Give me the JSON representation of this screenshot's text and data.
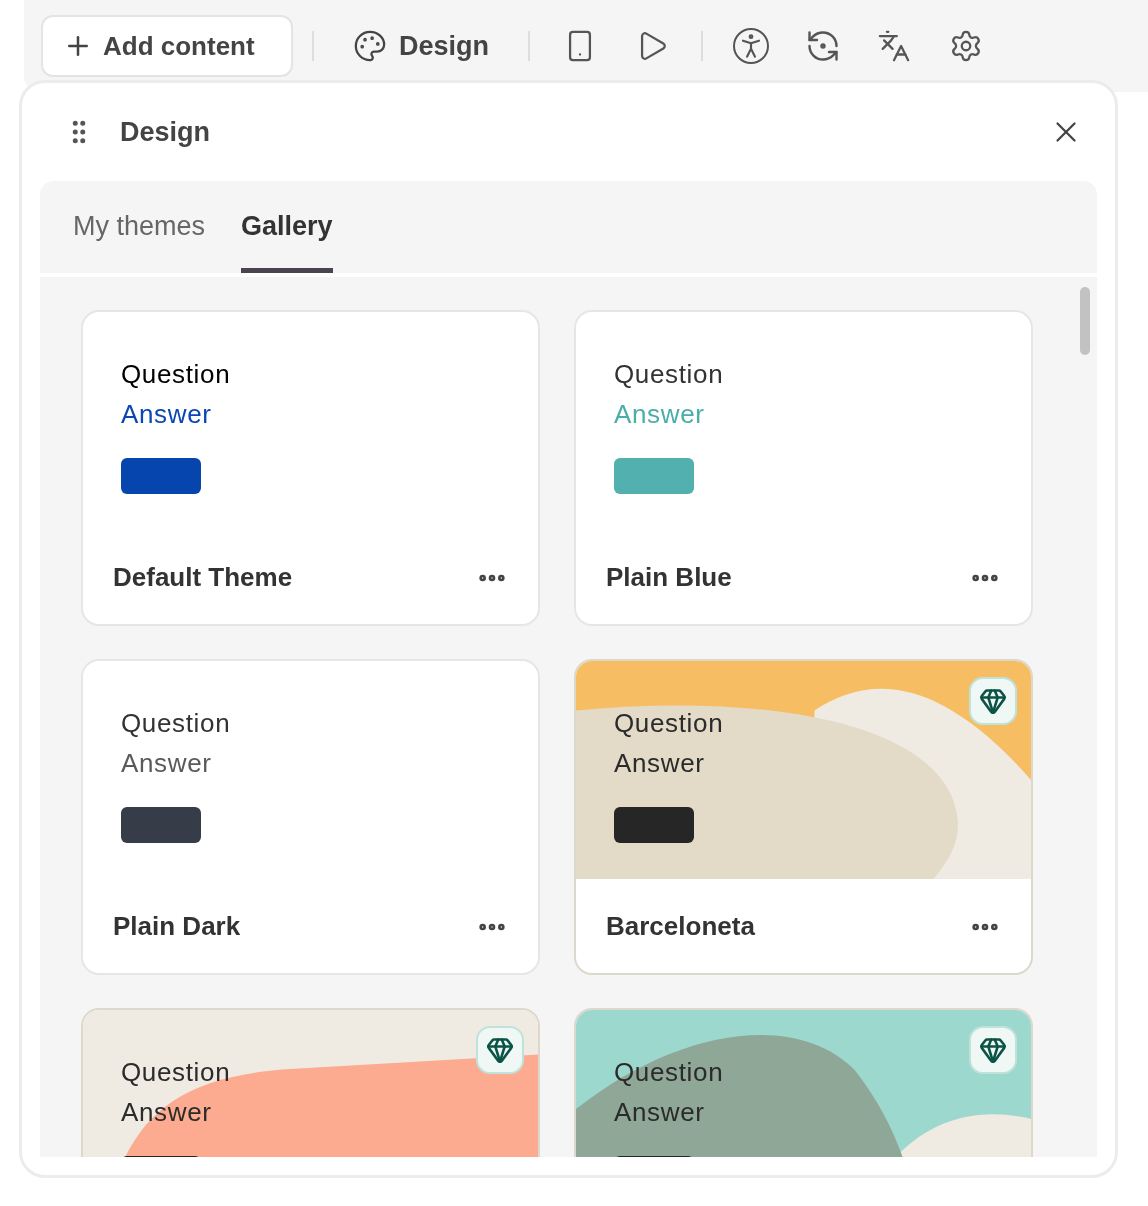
{
  "toolbar": {
    "add_button": "Add content",
    "design_button": "Design"
  },
  "panel": {
    "title": "Design",
    "tabs": [
      {
        "label": "My themes",
        "selected": false
      },
      {
        "label": "Gallery",
        "selected": true
      }
    ],
    "themes": [
      {
        "name": "Default Theme",
        "question": "Question",
        "answer": {
          "text": "Answer",
          "color": "#0a47b3"
        },
        "color": "#0645ad",
        "kind": "plain",
        "premium": false
      },
      {
        "name": "Plain Blue",
        "question": "Question",
        "answer": {
          "text": "Answer",
          "color": "#4aaea8"
        },
        "color": "#52b0ae",
        "kind": "plain",
        "premium": false
      },
      {
        "name": "Plain Dark",
        "question": "Question",
        "answer": {
          "text": "Answer",
          "color": "#5a5a5a"
        },
        "color": "#363d48",
        "kind": "plain",
        "premium": false
      },
      {
        "name": "Barceloneta",
        "question": "Question",
        "answer": {
          "text": "Answer",
          "color": "#2b2b2b"
        },
        "color": "#262626",
        "kind": "picture",
        "premium": true
      },
      {
        "question": "Question",
        "answer": {
          "text": "Answer",
          "color": "#2b2b2b"
        },
        "color": "#262626",
        "kind": "picture",
        "premium": true
      },
      {
        "question": "Question",
        "answer": {
          "text": "Answer",
          "color": "#2b2b2b"
        },
        "color": "#262626",
        "kind": "picture",
        "premium": true
      }
    ]
  }
}
